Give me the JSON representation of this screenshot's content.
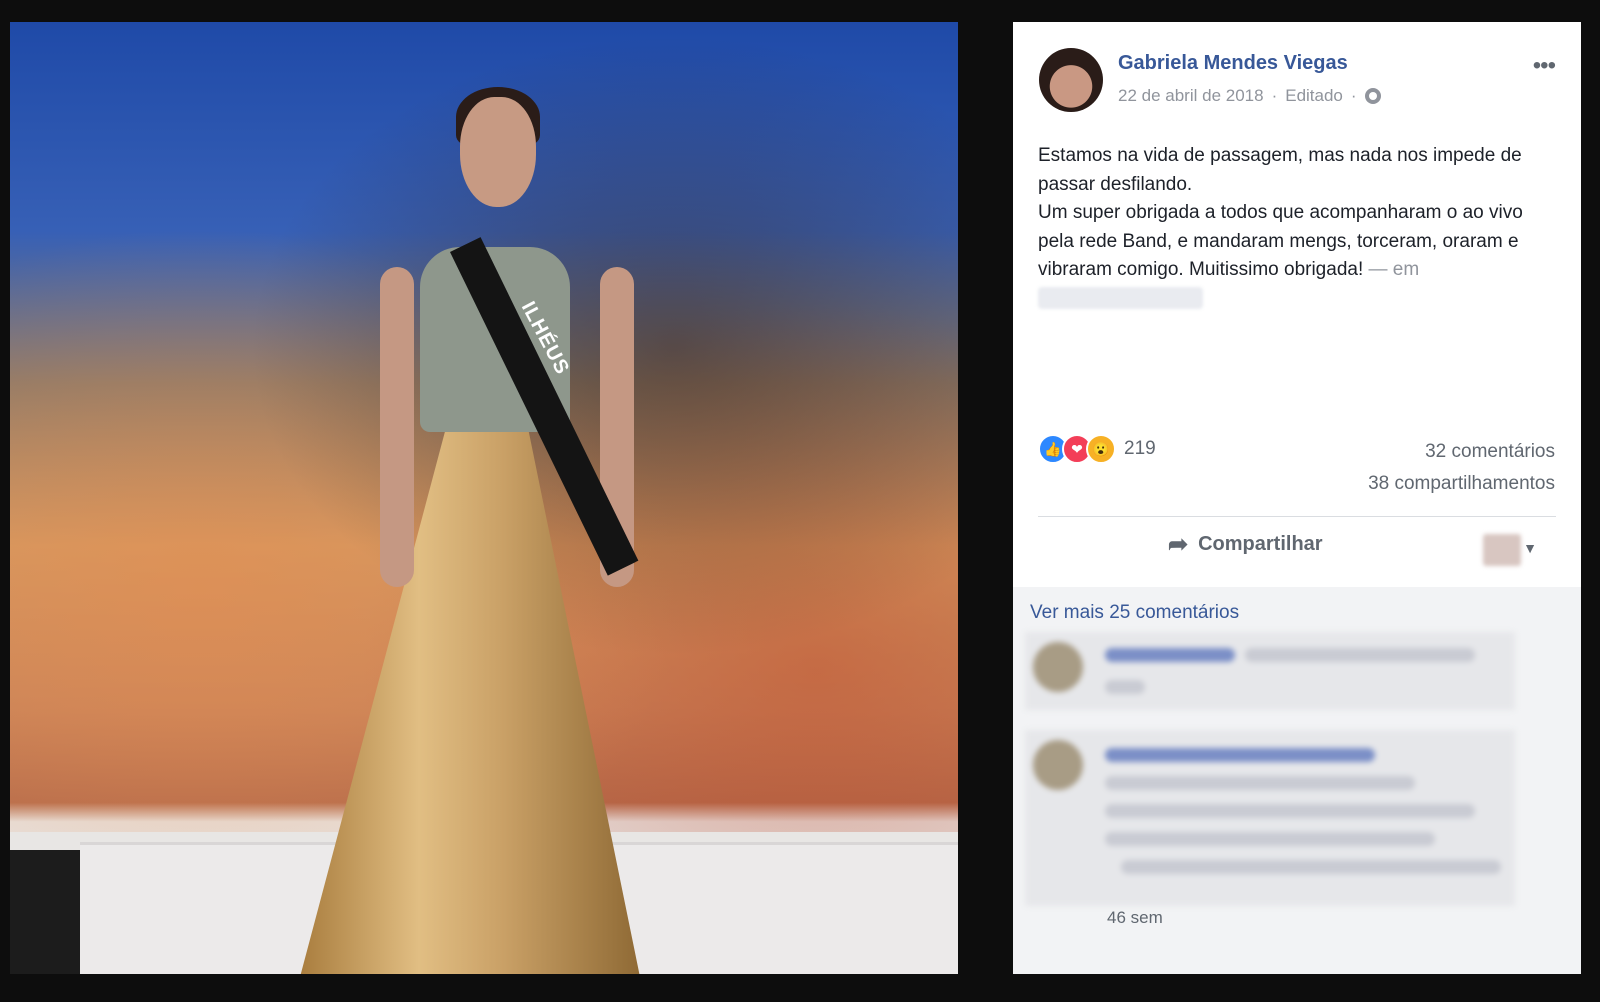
{
  "post": {
    "author": "Gabriela Mendes Viegas",
    "date": "22 de abril de 2018",
    "edited": "Editado",
    "separator": "·",
    "more_icon": "•••",
    "text_lines": [
      "Estamos na vida de passagem, mas nada nos impede de passar desfilando.",
      "Um super obrigada a todos que acompanharam o ao vivo pela rede Band, e mandaram mengs, torceram, oraram e vibraram comigo. Muitissimo obrigada!"
    ],
    "at_label": "— em",
    "reactions": {
      "count": "219",
      "like_icon": "like-reaction",
      "love_icon": "love-reaction",
      "wow_icon": "wow-reaction"
    },
    "comments_count": "32 comentários",
    "shares_count": "38 compartilhamentos",
    "share_label": "Compartilhar",
    "see_more_comments": "Ver mais 25 comentários",
    "comment_time": "46 sem"
  },
  "photo": {
    "sash_text": "ILHÉUS"
  },
  "colors": {
    "link": "#385898",
    "meta": "#90949c",
    "text": "#1d2129",
    "like": "#2d88ff",
    "love": "#f33e58",
    "wow": "#f7b125"
  }
}
